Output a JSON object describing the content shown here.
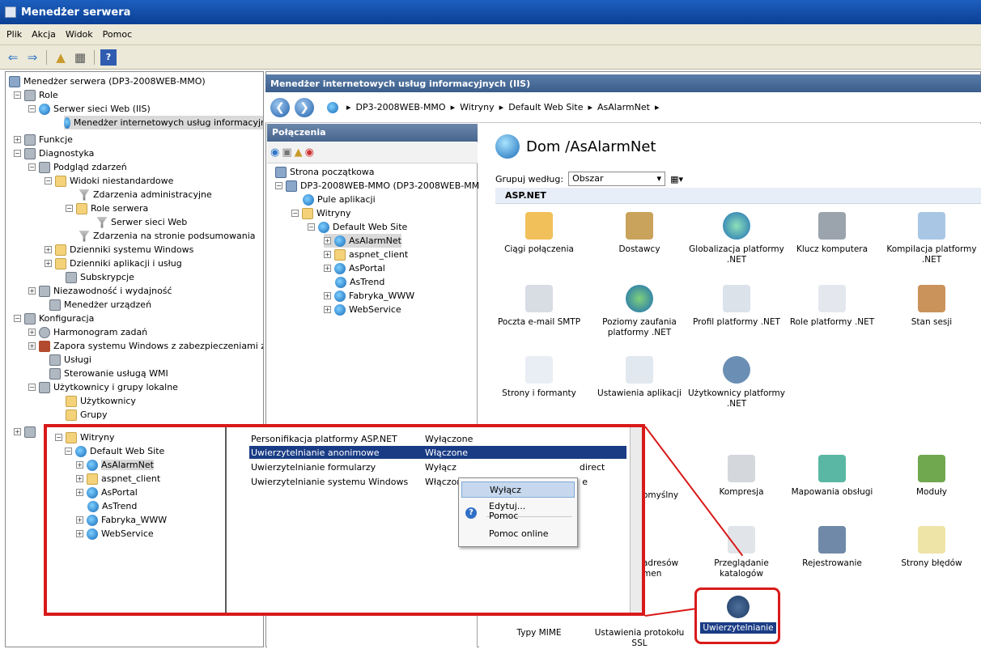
{
  "window": {
    "title": "Menedżer serwera"
  },
  "menu": [
    "Plik",
    "Akcja",
    "Widok",
    "Pomoc"
  ],
  "lefttree": {
    "items": [
      {
        "label": "Menedżer serwera (DP3-2008WEB-MMO)",
        "icon": "server-manager-icon"
      },
      {
        "label": "Role",
        "icon": "roles-icon"
      },
      {
        "label": "Serwer sieci Web (IIS)",
        "icon": "iis-icon"
      },
      {
        "label": "Menedżer internetowych usług informacyjn",
        "icon": "iis-manager-icon"
      },
      {
        "label": "Funkcje",
        "icon": "features-icon"
      },
      {
        "label": "Diagnostyka",
        "icon": "diagnostics-icon"
      },
      {
        "label": "Podgląd zdarzeń",
        "icon": "event-viewer-icon"
      },
      {
        "label": "Widoki niestandardowe",
        "icon": "folder-icon"
      },
      {
        "label": "Zdarzenia administracyjne",
        "icon": "filter-icon"
      },
      {
        "label": "Role serwera",
        "icon": "folder-icon"
      },
      {
        "label": "Serwer sieci Web",
        "icon": "filter-icon"
      },
      {
        "label": "Zdarzenia na stronie podsumowania",
        "icon": "filter-icon"
      },
      {
        "label": "Dzienniki systemu Windows",
        "icon": "folder-icon"
      },
      {
        "label": "Dzienniki aplikacji i usług",
        "icon": "folder-icon"
      },
      {
        "label": "Subskrypcje",
        "icon": "subscriptions-icon"
      },
      {
        "label": "Niezawodność i wydajność",
        "icon": "reliability-icon"
      },
      {
        "label": "Menedżer urządzeń",
        "icon": "device-manager-icon"
      },
      {
        "label": "Konfiguracja",
        "icon": "configuration-icon"
      },
      {
        "label": "Harmonogram zadań",
        "icon": "clock-icon"
      },
      {
        "label": "Zapora systemu Windows z zabezpieczeniami z",
        "icon": "firewall-icon"
      },
      {
        "label": "Usługi",
        "icon": "services-icon"
      },
      {
        "label": "Sterowanie usługą WMI",
        "icon": "wmi-icon"
      },
      {
        "label": "Użytkownicy i grupy lokalne",
        "icon": "users-groups-icon"
      },
      {
        "label": "Użytkownicy",
        "icon": "folder-icon"
      },
      {
        "label": "Grupy",
        "icon": "folder-icon"
      }
    ]
  },
  "iis": {
    "header": "Menedżer internetowych usług informacyjnych (IIS)",
    "breadcrumb": [
      "DP3-2008WEB-MMO",
      "Witryny",
      "Default Web Site",
      "AsAlarmNet"
    ],
    "connections": {
      "title": "Połączenia",
      "tree": [
        "Strona początkowa",
        "DP3-2008WEB-MMO (DP3-2008WEB-MM",
        "Pule aplikacji",
        "Witryny",
        "Default Web Site",
        "AsAlarmNet",
        "aspnet_client",
        "AsPortal",
        "AsTrend",
        "Fabryka_WWW",
        "WebService"
      ]
    },
    "home_title": "Dom /AsAlarmNet",
    "group_by_label": "Grupuj według:",
    "group_by_value": "Obszar",
    "section_aspnet": "ASP.NET",
    "icons_row1": [
      "Ciągi połączenia",
      "Dostawcy",
      "Globalizacja platformy .NET",
      "Klucz komputera",
      "Kompilacja platformy .NET"
    ],
    "icons_row2": [
      "Poczta e-mail SMTP",
      "Poziomy zaufania platformy .NET",
      "Profil platformy .NET",
      "Role platformy .NET",
      "Stan sesji"
    ],
    "icons_row3": [
      "Strony i formanty",
      "Ustawienia aplikacji",
      "Użytkownicy platformy .NET"
    ],
    "icons_iis_row1": [
      "omyślny",
      "Kompresja",
      "Mapowania obsługi",
      "Moduły"
    ],
    "icons_iis_row2": [
      "adresów\nmen",
      "Przeglądanie katalogów",
      "Rejestrowanie",
      "Strony błędów"
    ],
    "icons_iis_row3": [
      "Typy MIME",
      "Ustawienia protokołu SSL",
      "Uwierzytelnianie"
    ]
  },
  "overlay": {
    "tree": [
      "Witryny",
      "Default Web Site",
      "AsAlarmNet",
      "aspnet_client",
      "AsPortal",
      "AsTrend",
      "Fabryka_WWW",
      "WebService"
    ],
    "rows": [
      {
        "name": "Personifikacja platformy ASP.NET",
        "status": "Wyłączone",
        "extra": ""
      },
      {
        "name": "Uwierzytelnianie anonimowe",
        "status": "Włączone",
        "extra": ""
      },
      {
        "name": "Uwierzytelnianie formularzy",
        "status": "Wyłącz",
        "extra": "direct"
      },
      {
        "name": "Uwierzytelnianie systemu Windows",
        "status": "Włączon",
        "extra": "e"
      }
    ],
    "context_menu": [
      "Wyłącz",
      "Edytuj...",
      "Pomoc",
      "Pomoc online"
    ]
  }
}
